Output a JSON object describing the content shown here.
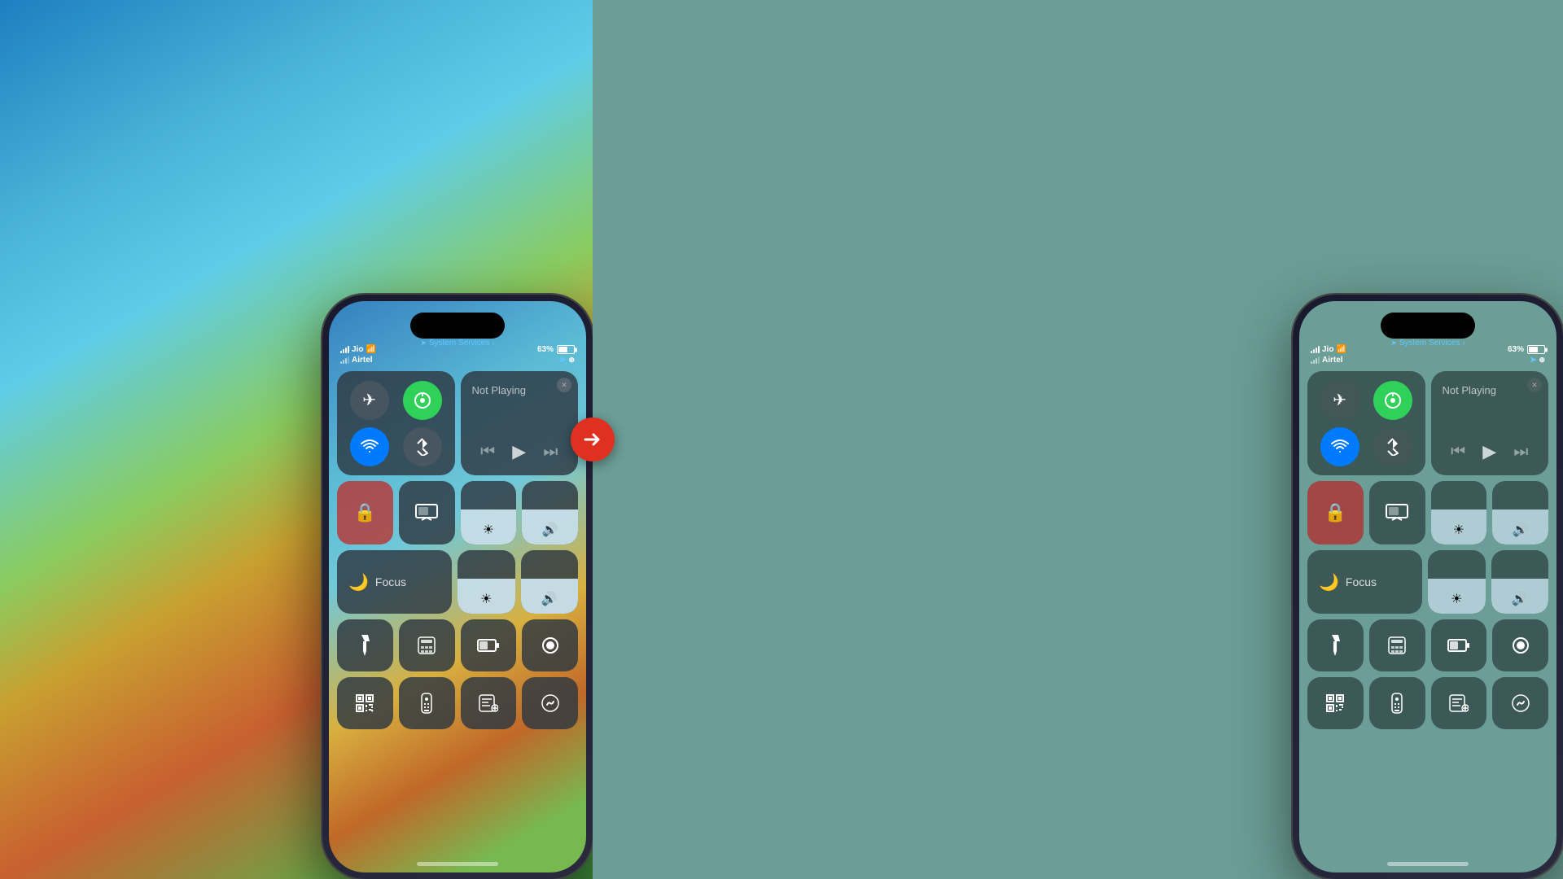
{
  "left_phone": {
    "status_bar": {
      "carrier1": "Jio",
      "carrier2": "Airtel",
      "battery": "63%",
      "location_text": "System Services"
    },
    "connectivity": {
      "airplane_icon": "✈",
      "cellular_icon": "📶",
      "wifi_icon": "wifi",
      "bluetooth_icon": "bluetooth"
    },
    "now_playing": {
      "text": "Not Playing",
      "rewind": "⏮",
      "play": "▶",
      "forward": "⏭"
    },
    "second_row": {
      "lock_icon": "🔒",
      "mirror_icon": "mirror",
      "brightness_level": 55,
      "volume_level": 55
    },
    "focus": {
      "label": "Focus",
      "icon": "🌙"
    },
    "buttons_row1": [
      "flashlight",
      "calculator",
      "battery",
      "record"
    ],
    "buttons_row2": [
      "qr",
      "remote",
      "notes",
      "shazam"
    ]
  },
  "right_phone": {
    "status_bar": {
      "carrier1": "Jio",
      "carrier2": "Airtel",
      "battery": "63%",
      "location_text": "System Services"
    },
    "now_playing": {
      "text": "Not Playing"
    },
    "focus": {
      "label": "Focus"
    }
  },
  "arrow": "→",
  "background": {
    "left_colors": [
      "#1a6fa8",
      "#5bc8e8",
      "#d4a843",
      "#c85a2a"
    ],
    "right_color": "#6b9e96"
  }
}
